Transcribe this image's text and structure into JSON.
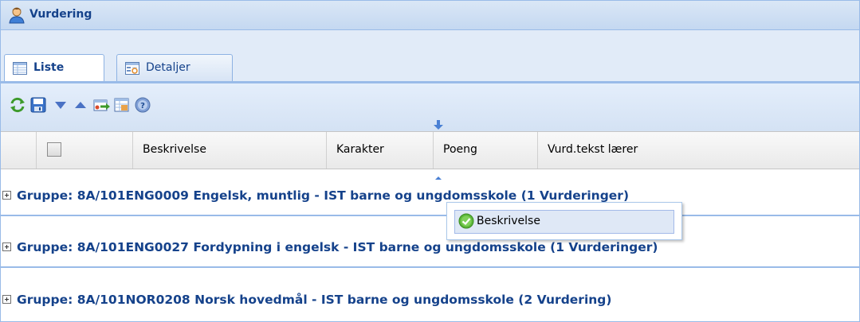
{
  "panel": {
    "title": "Vurdering",
    "icon": "user-icon"
  },
  "tabs": [
    {
      "label": "Liste",
      "icon": "grid-list-icon",
      "active": true
    },
    {
      "label": "Detaljer",
      "icon": "detail-form-icon",
      "active": false
    }
  ],
  "toolbar": {
    "buttons": [
      "refresh-icon",
      "save-icon",
      "move-down-icon",
      "move-up-icon",
      "export-icon",
      "import-icon",
      "help-icon"
    ]
  },
  "grid": {
    "columns": [
      "Beskrivelse",
      "Karakter",
      "Poeng",
      "Vurd.tekst lærer"
    ],
    "groups": [
      "Gruppe: 8A/101ENG0009 Engelsk, muntlig - IST barne og ungdomsskole (1 Vurderinger)",
      "Gruppe: 8A/101ENG0027 Fordypning i engelsk - IST barne og ungdomsskole (1 Vurderinger)",
      "Gruppe: 8A/101NOR0208 Norsk hovedmål - IST barne og ungdomsskole (2 Vurdering)"
    ]
  },
  "drag_indicator": {
    "label": "Beskrivelse",
    "icon": "checkmark-icon"
  },
  "colors": {
    "accent": "#15428b",
    "border": "#99bbe8",
    "popup_bg": "#dfe8f6"
  }
}
